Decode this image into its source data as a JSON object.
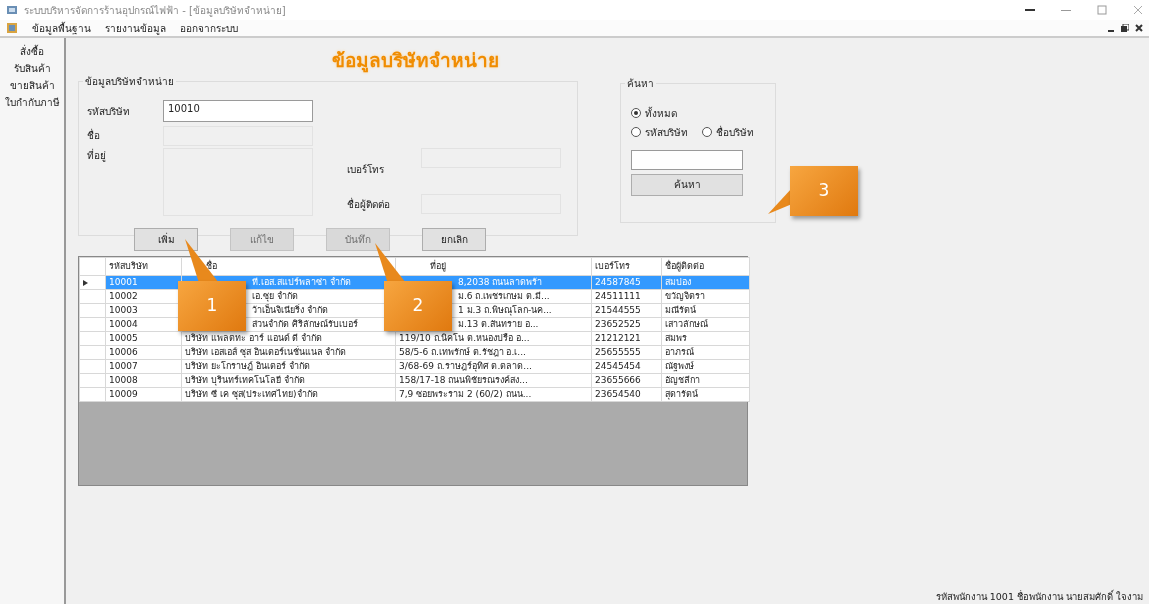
{
  "window": {
    "title": "ระบบบริหารจัดการร้านอุปกรณ์ไฟฟ้า - [ข้อมูลบริษัทจำหน่าย]"
  },
  "menu": [
    {
      "label": "ข้อมูลพื้นฐาน"
    },
    {
      "label": "รายงานข้อมูล"
    },
    {
      "label": "ออกจากระบบ"
    }
  ],
  "sidebar": {
    "items": [
      {
        "label": "สั่งซื้อ"
      },
      {
        "label": "รับสินค้า"
      },
      {
        "label": "ขายสินค้า"
      },
      {
        "label": "ใบกำกับภาษี"
      }
    ]
  },
  "page_title": "ข้อมูลบริษัทจำหน่าย",
  "supplier_form": {
    "legend": "ข้อมูลบริษัทจำหน่าย",
    "fields": [
      {
        "label": "รหัสบริษัท",
        "value": "10010"
      },
      {
        "label": "ชื่อ"
      },
      {
        "label": "ที่อยู่"
      },
      {
        "label": "เบอร์โทร"
      },
      {
        "label": "ชื่อผู้ติดต่อ"
      }
    ],
    "buttons": [
      {
        "label": "เพิ่ม",
        "disabled": false
      },
      {
        "label": "แก้ไข",
        "disabled": true
      },
      {
        "label": "บันทึก",
        "disabled": true
      },
      {
        "label": "ยกเลิก",
        "disabled": false
      }
    ]
  },
  "search": {
    "legend": "ค้นหา",
    "options": [
      {
        "label": "ทั้งหมด",
        "selected": true
      },
      {
        "label": "รหัสบริษัท",
        "selected": false
      },
      {
        "label": "ชื่อบริษัท",
        "selected": false
      }
    ],
    "button": "ค้นหา"
  },
  "table": {
    "columns": [
      "รหัสบริษัท",
      "ชื่อ",
      "ที่อยู่",
      "เบอร์โทร",
      "ชื่อผู้ติดต่อ"
    ],
    "rows": [
      {
        "selected": true,
        "cells": [
          "10001",
          "ที.เอส.สแปร์พลาซ่า จำกัด",
          "8,2038 ถนนลาดพร้า",
          "24587845",
          "สมปอง"
        ]
      },
      {
        "selected": false,
        "cells": [
          "10002",
          "เอ.ซุย จำกัด",
          "ม.6 ถ.เพชรเกษม ต.มี...",
          "24511111",
          "ขวัญจิตรา"
        ]
      },
      {
        "selected": false,
        "cells": [
          "10003",
          "ว้าเอ็นจิเนียริ่ง จำกัด",
          "1 ม.3 ถ.พิษณุโลก-นค...",
          "21544555",
          "มณีรัตน์"
        ]
      },
      {
        "selected": false,
        "cells": [
          "10004",
          "ส่วนจำกัด ศิริลักษณ์รับเบอร์",
          "ม.13 ต.สันทราย อ...",
          "23652525",
          "เสาวลักษณ์"
        ]
      },
      {
        "selected": false,
        "cells": [
          "10005",
          "บริษัท แพลตทะ อาร์ แอนด์ ดี จำกัด",
          "119/10 ถ.นิคโน ต.หนองปรือ อ...",
          "21212121",
          "สมพร"
        ]
      },
      {
        "selected": false,
        "cells": [
          "10006",
          "บริษัท เอสเอส์ ซุส อินเตอร์เนชั่นแนล จำกัด",
          "58/5-6 ถ.เทพรักษ์ ต.รัชฎา อ.เ...",
          "25655555",
          "อาภรณ์"
        ]
      },
      {
        "selected": false,
        "cells": [
          "10007",
          "บริษัท ยะโกราษฎ์ อินเตอร์ จำกัด",
          "3/68-69 ถ.ราษฎร์อุทิศ ต.ตลาด...",
          "24545454",
          "ณัฐพงษ์"
        ]
      },
      {
        "selected": false,
        "cells": [
          "10008",
          "บริษัท บุรินทร์เทคโนโลยี จำกัด",
          "158/17-18 ถนนพิชัยรณรงค์สง...",
          "23655666",
          "อัญชลีกา"
        ]
      },
      {
        "selected": false,
        "cells": [
          "10009",
          "บริษัท ซี เค ซุส(ประเทศไทย)จำกัด",
          "7,9 ซอยพระราม 2 (60/2) ถนน...",
          "23654540",
          "สุดารัตน์"
        ]
      }
    ]
  },
  "callouts": [
    {
      "number": "1"
    },
    {
      "number": "2"
    },
    {
      "number": "3"
    }
  ],
  "status_bar": "รหัสพนักงาน 1001 ชื่อพนักงาน นายสมศักดิ์ ใจงาม"
}
